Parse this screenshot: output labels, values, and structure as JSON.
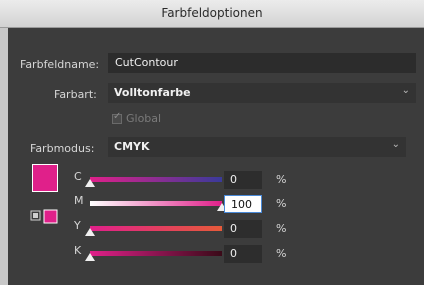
{
  "window": {
    "title": "Farbfeldoptionen"
  },
  "form": {
    "name_label": "Farbfeldname:",
    "name_value": "CutContour",
    "type_label": "Farbart:",
    "type_value": "Volltonfarbe",
    "global_label": "Global",
    "mode_label": "Farbmodus:",
    "mode_value": "CMYK"
  },
  "colors": {
    "swatch": "#e0208a"
  },
  "channels": [
    {
      "label": "C",
      "value": "0",
      "unit": "%",
      "level": 0
    },
    {
      "label": "M",
      "value": "100",
      "unit": "%",
      "level": 1
    },
    {
      "label": "Y",
      "value": "0",
      "unit": "%",
      "level": 0
    },
    {
      "label": "K",
      "value": "0",
      "unit": "%",
      "level": 0
    }
  ]
}
